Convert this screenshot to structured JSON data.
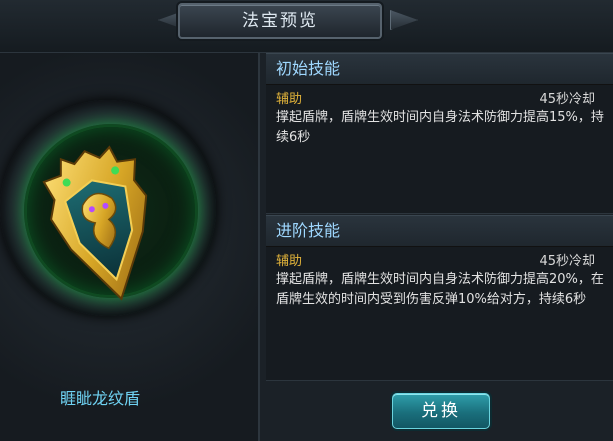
{
  "header": {
    "title": "法宝预览"
  },
  "item": {
    "name": "睚眦龙纹盾"
  },
  "skills": [
    {
      "heading": "初始技能",
      "tag": "辅助",
      "cooldown": "45秒冷却",
      "description": "撑起盾牌，盾牌生效时间内自身法术防御力提高15%，持续6秒"
    },
    {
      "heading": "进阶技能",
      "tag": "辅助",
      "cooldown": "45秒冷却",
      "description": "撑起盾牌，盾牌生效时间内自身法术防御力提高20%，在盾牌生效的时间内受到伤害反弹10%给对方，持续6秒"
    }
  ],
  "actions": {
    "redeem_label": "兑换"
  },
  "colors": {
    "accent": "#6fd2f2",
    "tag": "#e0b23a",
    "button": "#1a6f7c"
  }
}
